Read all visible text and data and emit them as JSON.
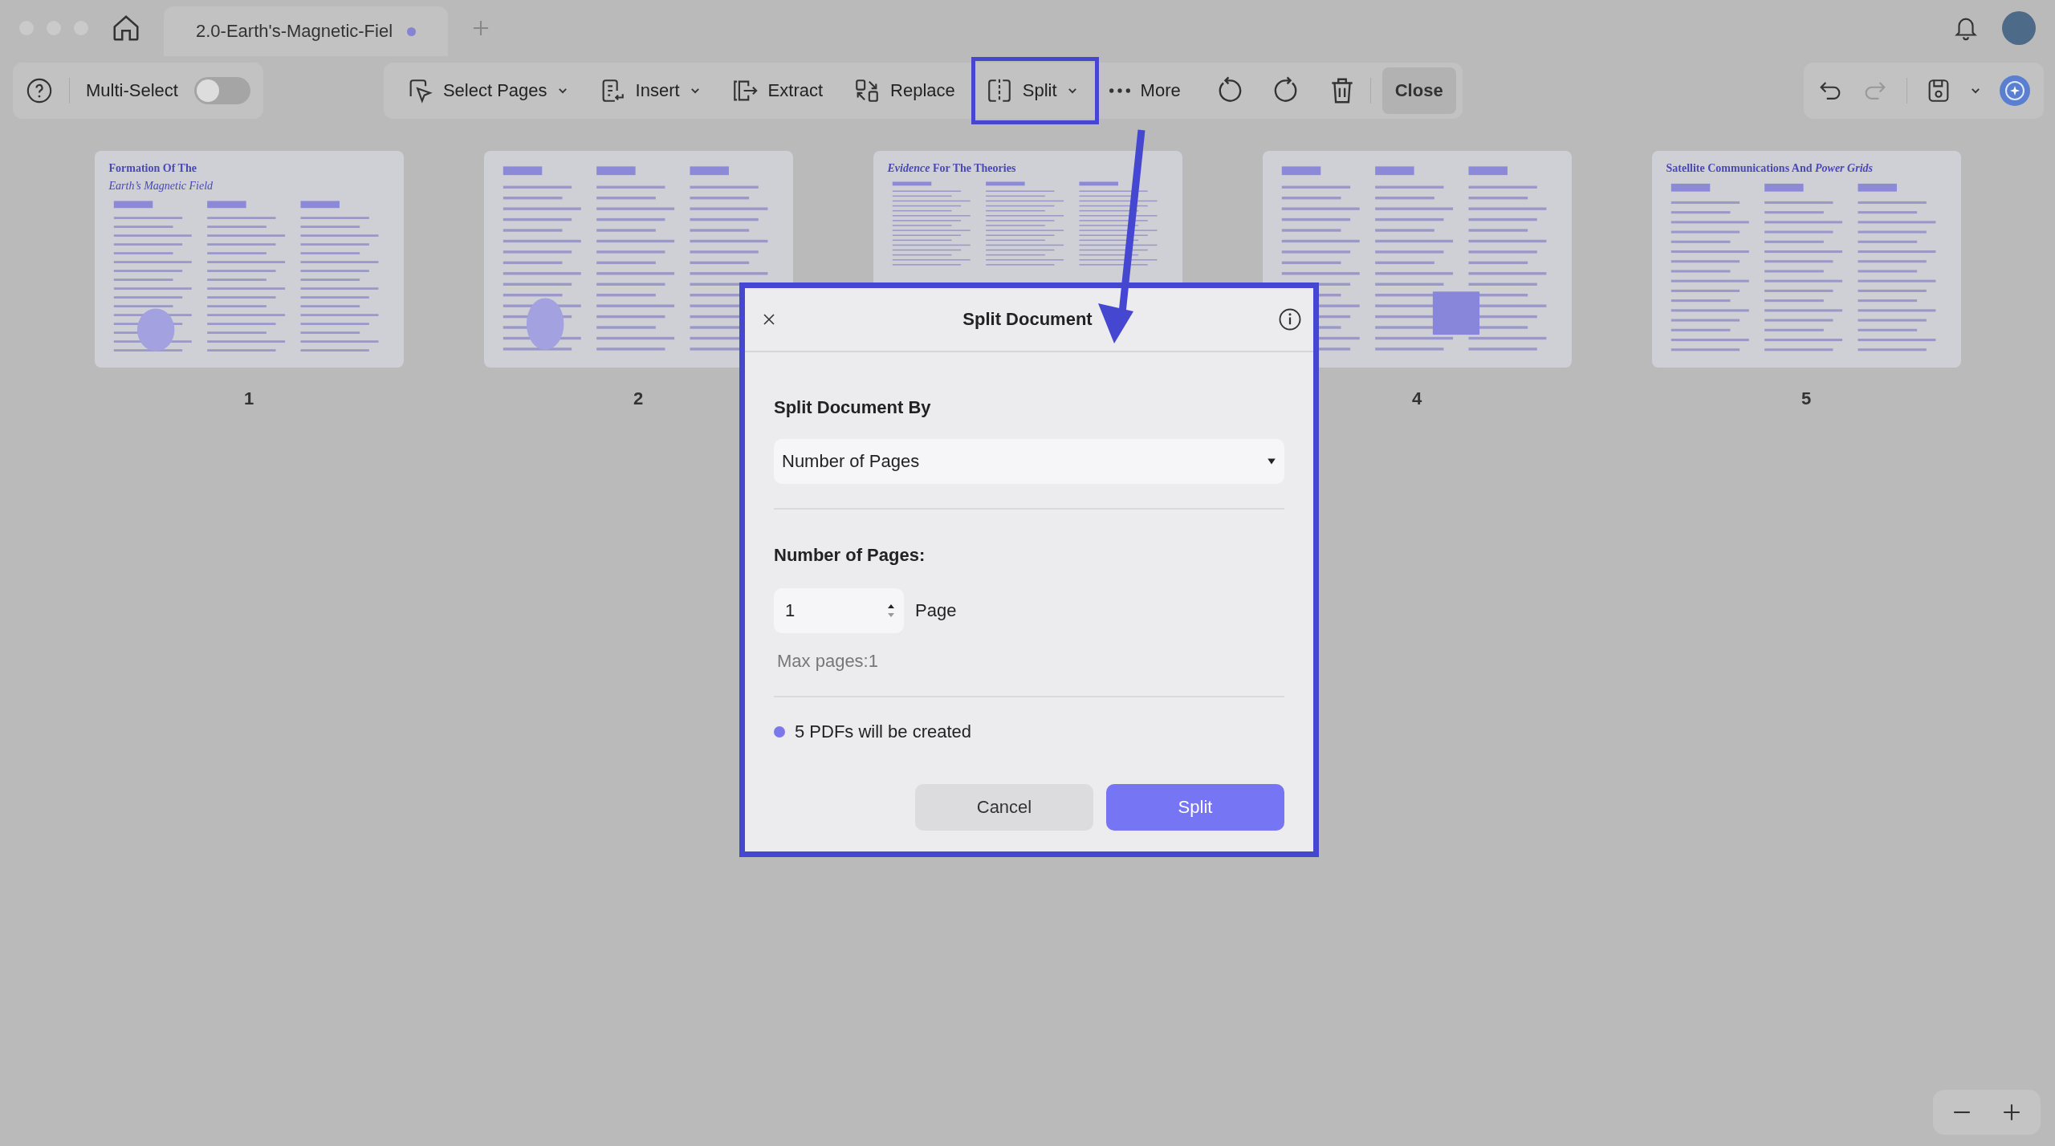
{
  "tab_bar": {
    "document_tab": {
      "title": "2.0-Earth's-Magnetic-Fiel",
      "modified": true
    }
  },
  "toolbar": {
    "multi_select": {
      "label": "Multi-Select",
      "on": false
    },
    "tools": [
      {
        "label": "Select Pages",
        "dropdown": true,
        "annotated": false
      },
      {
        "label": "Insert",
        "dropdown": true,
        "annotated": false
      },
      {
        "label": "Extract",
        "dropdown": false,
        "annotated": false
      },
      {
        "label": "Replace",
        "dropdown": false,
        "annotated": false
      },
      {
        "label": "Split",
        "dropdown": true,
        "annotated": true
      },
      {
        "label": "More",
        "dropdown": false,
        "annotated": false
      }
    ],
    "close": "Close"
  },
  "pages": [
    {
      "number": "1",
      "title": "Formation Of The",
      "subtitle": "Earth’s Magnetic Field"
    },
    {
      "number": "2"
    },
    {
      "title": "*Evidence* For The Theories"
    },
    {
      "number": "4"
    },
    {
      "number": "5",
      "title": "Satellite Communications And *Power Grids*"
    }
  ],
  "dialog": {
    "title": "Split Document",
    "section_label": "Split Document By",
    "mode_select": {
      "value": "Number of Pages"
    },
    "count_label": "Number of Pages:",
    "count_field": {
      "value": "1"
    },
    "unit": "Page",
    "hint": "Max pages:1",
    "result": "5 PDFs will be created",
    "buttons": [
      {
        "label": "Cancel",
        "primary": false
      },
      {
        "label": "Split",
        "primary": true
      }
    ]
  }
}
